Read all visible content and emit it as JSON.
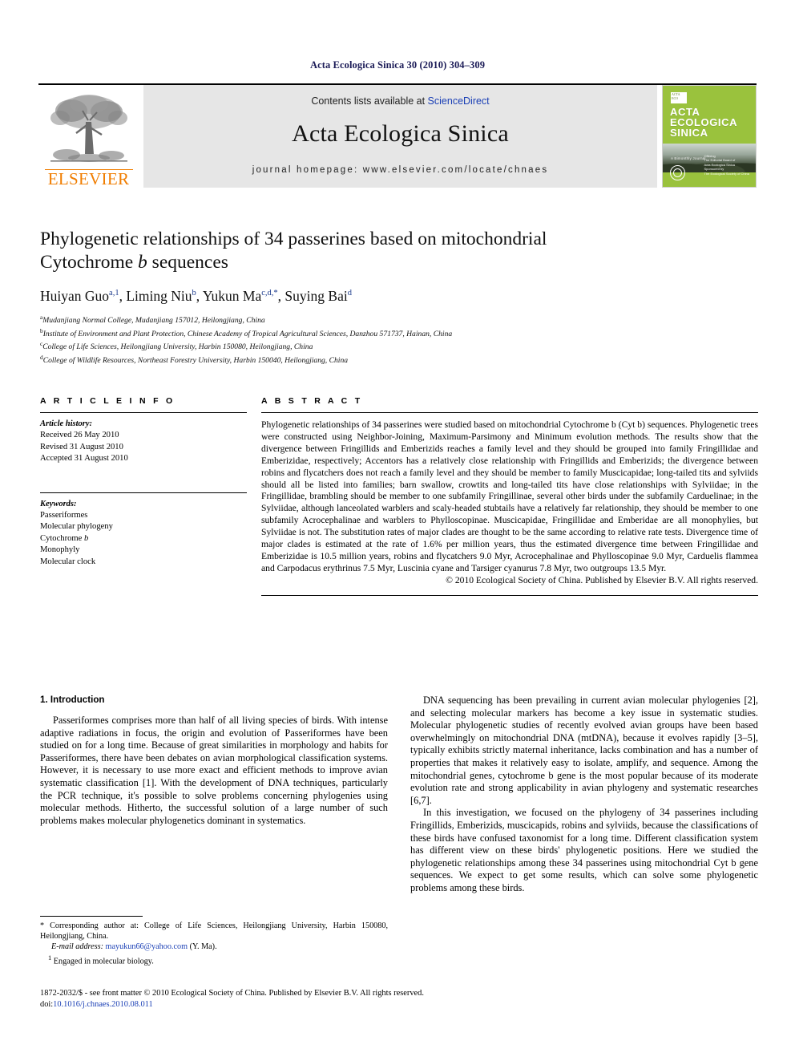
{
  "running_head": "Acta Ecologica Sinica 30 (2010) 304–309",
  "masthead": {
    "contents_prefix": "Contents lists available at ",
    "sciencedirect": "ScienceDirect",
    "journal_title": "Acta Ecologica Sinica",
    "homepage": "journal homepage: www.elsevier.com/locate/chnaes",
    "publisher_word": "ELSEVIER",
    "cover": {
      "badge_text": "ACTA ECOLOGICA SINICA",
      "title_lines": [
        "ACTA",
        "ECOLOGICA",
        "SINICA"
      ],
      "subtitle": "A Bimonthly Journal",
      "footer_lines": [
        "Offering",
        "The Editorial Board of",
        "Acta Ecologica Sinica",
        "Sponsored by",
        "The Ecological Society of China"
      ]
    }
  },
  "article": {
    "title_line1": "Phylogenetic relationships of 34 passerines based on mitochondrial",
    "title_line2_pre": "Cytochrome ",
    "title_line2_ital": "b",
    "title_line2_post": " sequences",
    "authors": [
      {
        "name": "Huiyan Guo",
        "sup": "a,1",
        "sep": ", "
      },
      {
        "name": "Liming Niu",
        "sup": "b",
        "sep": ", "
      },
      {
        "name": "Yukun Ma",
        "sup": "c,d,*",
        "sep": ", "
      },
      {
        "name": "Suying Bai",
        "sup": "d",
        "sep": ""
      }
    ],
    "affiliations": [
      {
        "mark": "a",
        "text": "Mudanjiang Normal College, Mudanjiang 157012, Heilongjiang, China"
      },
      {
        "mark": "b",
        "text": "Institute of Environment and Plant Protection, Chinese Academy of Tropical Agricultural Sciences, Danzhou 571737, Hainan, China"
      },
      {
        "mark": "c",
        "text": "College of Life Sciences, Heilongjiang University, Harbin 150080, Heilongjiang, China"
      },
      {
        "mark": "d",
        "text": "College of Wildlife Resources, Northeast Forestry University, Harbin 150040, Heilongjiang, China"
      }
    ]
  },
  "article_info": {
    "heading": "A R T I C L E    I N F O",
    "history_label": "Article history:",
    "history": [
      "Received 26 May 2010",
      "Revised 31 August 2010",
      "Accepted 31 August 2010"
    ],
    "keywords_label": "Keywords:",
    "keywords": [
      "Passeriformes",
      "Molecular phylogeny",
      "Cytochrome b",
      "Monophyly",
      "Molecular clock"
    ]
  },
  "abstract": {
    "heading": "A B S T R A C T",
    "text": "Phylogenetic relationships of 34 passerines were studied based on mitochondrial Cytochrome b (Cyt b) sequences. Phylogenetic trees were constructed using Neighbor-Joining, Maximum-Parsimony and Minimum evolution methods. The results show that the divergence between Fringillids and Emberizids reaches a family level and they should be grouped into family Fringillidae and Emberizidae, respectively; Accentors has a relatively close relationship with Fringillids and Emberizids; the divergence between robins and flycatchers does not reach a family level and they should be member to family Muscicapidae; long-tailed tits and sylviids should all be listed into families; barn swallow, crowtits and long-tailed tits have close relationships with Sylviidae; in the Fringillidae, brambling should be member to one subfamily Fringillinae, several other birds under the subfamily Carduelinae; in the Sylviidae, although lanceolated warblers and scaly-headed stubtails have a relatively far relationship, they should be member to one subfamily Acrocephalinae and warblers to Phylloscopinae. Muscicapidae, Fringillidae and Emberidae are all monophylies, but Sylviidae is not. The substitution rates of major clades are thought to be the same according to relative rate tests. Divergence time of major clades is estimated at the rate of 1.6% per million years, thus the estimated divergence time between Fringillidae and Emberizidae is 10.5 million years, robins and flycatchers 9.0 Myr, Acrocephalinae and Phylloscopinae 9.0 Myr, Carduelis flammea and Carpodacus erythrinus 7.5 Myr, Luscinia cyane and Tarsiger cyanurus 7.8 Myr, two outgroups 13.5 Myr.",
    "copyright": "© 2010 Ecological Society of China. Published by Elsevier B.V. All rights reserved."
  },
  "introduction": {
    "heading": "1. Introduction",
    "left_paragraph": "Passeriformes comprises more than half of all living species of birds. With intense adaptive radiations in focus, the origin and evolution of Passeriformes have been studied on for a long time. Because of great similarities in morphology and habits for Passeriformes, there have been debates on avian morphological classification systems. However, it is necessary to use more exact and efficient methods to improve avian systematic classification [1]. With the development of DNA techniques, particularly the PCR technique, it's possible to solve problems concerning phylogenies using molecular methods. Hitherto, the successful solution of a large number of such problems makes molecular phylogenetics dominant in systematics.",
    "right_paragraph_1": "DNA sequencing has been prevailing in current avian molecular phylogenies [2], and selecting molecular markers has become a key issue in systematic studies. Molecular phylogenetic studies of recently evolved avian groups have been based overwhelmingly on mitochondrial DNA (mtDNA), because it evolves rapidly [3–5], typically exhibits strictly maternal inheritance, lacks combination and has a number of properties that makes it relatively easy to isolate, amplify, and sequence. Among the mitochondrial genes, cytochrome b gene is the most popular because of its moderate evolution rate and strong applicability in avian phylogeny and systematic researches [6,7].",
    "right_paragraph_2": "In this investigation, we focused on the phylogeny of 34 passerines including Fringillids, Emberizids, muscicapids, robins and sylviids, because the classifications of these birds have confused taxonomist for a long time. Different classification system has different view on these birds' phylogenetic positions. Here we studied the phylogenetic relationships among these 34 passerines using mitochondrial Cyt b gene sequences. We expect to get some results, which can solve some phylogenetic problems among these birds."
  },
  "footnotes": {
    "corresponding": "* Corresponding author at: College of Life Sciences, Heilongjiang University, Harbin 150080, Heilongjiang, China.",
    "email_label": "E-mail address:",
    "email": "mayukun66@yahoo.com",
    "email_suffix": "(Y. Ma).",
    "note1_mark": "1",
    "note1": "Engaged in molecular biology."
  },
  "bottom": {
    "issn_line": "1872-2032/$ - see front matter © 2010 Ecological Society of China. Published by Elsevier B.V. All rights reserved.",
    "doi_label": "doi:",
    "doi": "10.1016/j.chnaes.2010.08.011"
  }
}
